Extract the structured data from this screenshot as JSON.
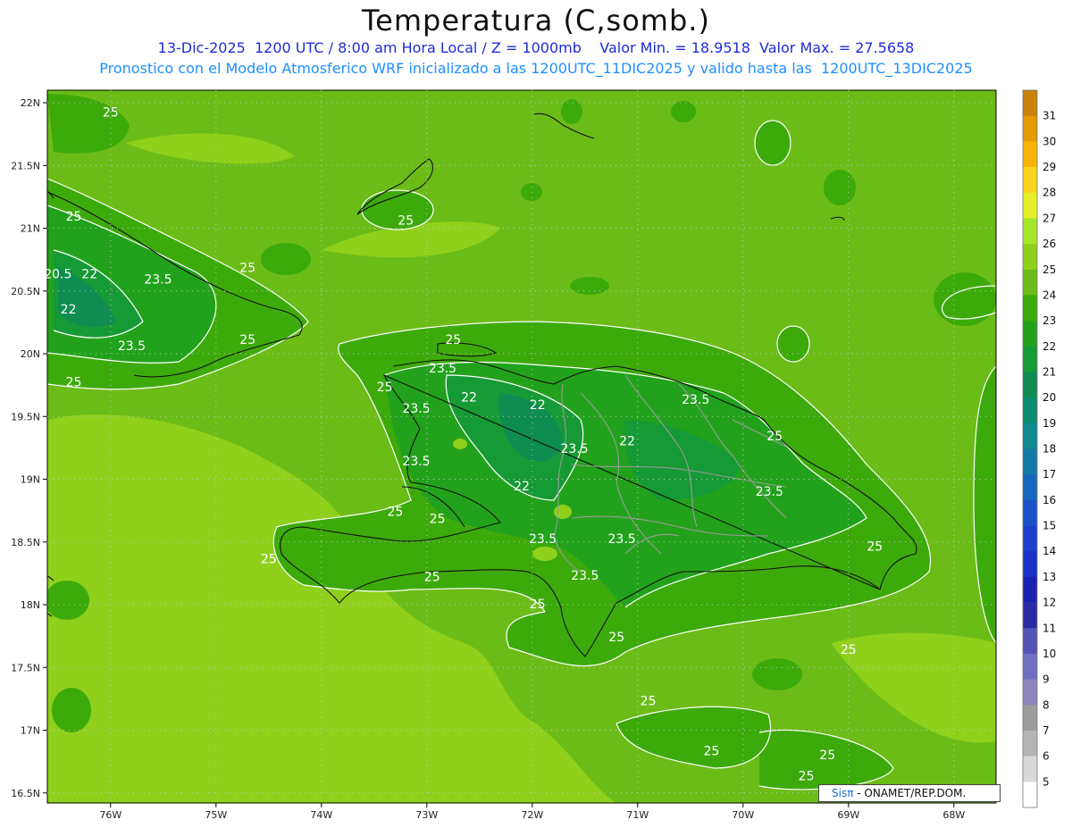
{
  "title": "Temperatura (C,somb.)",
  "subtitle_line1": "13-Dic-2025  1200 UTC / 8:00 am Hora Local / Z = 1000mb    Valor Min. = 18.9518  Valor Max. = 27.5658",
  "subtitle_line2": "Pronostico con el Modelo Atmosferico WRF inicializado a las 1200UTC_11DIC2025 y valido hasta las  1200UTC_13DIC2025",
  "credit": {
    "brand": "Sisπ",
    "text": " - ONAMET/REP.DOM."
  },
  "axes": {
    "lon_ticks": [
      "76W",
      "75W",
      "74W",
      "73W",
      "72W",
      "71W",
      "70W",
      "69W",
      "68W"
    ],
    "lon_values": [
      -76,
      -75,
      -74,
      -73,
      -72,
      -71,
      -70,
      -69,
      -68
    ],
    "lat_ticks": [
      "22N",
      "21.5N",
      "21N",
      "20.5N",
      "20N",
      "19.5N",
      "19N",
      "18.5N",
      "18N",
      "17.5N",
      "17N",
      "16.5N"
    ],
    "lat_values": [
      22,
      21.5,
      21,
      20.5,
      20,
      19.5,
      19,
      18.5,
      18,
      17.5,
      17,
      16.5
    ],
    "lon_range": [
      -76.6,
      -67.6
    ],
    "lat_range": [
      16.42,
      22.1
    ]
  },
  "colorbar": {
    "labels": [
      "31",
      "30",
      "29",
      "28",
      "27",
      "26",
      "25",
      "24",
      "23",
      "22",
      "21",
      "20",
      "19",
      "18",
      "17",
      "16",
      "15",
      "14",
      "13",
      "12",
      "11",
      "10",
      "9",
      "8",
      "7",
      "6",
      "5"
    ],
    "colors": [
      "#c8820a",
      "#e59a00",
      "#f7b400",
      "#fbd41e",
      "#e6ee2a",
      "#a6e62a",
      "#8fd01c",
      "#6cbc18",
      "#3daa0c",
      "#22a21c",
      "#169a36",
      "#0e8c52",
      "#0a8c70",
      "#0e8a8e",
      "#137aa8",
      "#1766bf",
      "#1c52c8",
      "#1c40cb",
      "#1a30c6",
      "#1c22b0",
      "#2a2aa6",
      "#5454b6",
      "#7070c2",
      "#8e86bc",
      "#9c9c9c",
      "#b4b4b4",
      "#d8d8d8",
      "#ffffff"
    ]
  },
  "contour_labels": [
    {
      "text": "25",
      "lon": -76.0,
      "lat": 21.89
    },
    {
      "text": "25",
      "lon": -73.2,
      "lat": 21.03
    },
    {
      "text": "25",
      "lon": -76.35,
      "lat": 21.06
    },
    {
      "text": "20.5",
      "lon": -76.5,
      "lat": 20.6
    },
    {
      "text": "22",
      "lon": -76.2,
      "lat": 20.6
    },
    {
      "text": "23.5",
      "lon": -75.55,
      "lat": 20.56
    },
    {
      "text": "22",
      "lon": -76.4,
      "lat": 20.32
    },
    {
      "text": "23.5",
      "lon": -75.8,
      "lat": 20.03
    },
    {
      "text": "25",
      "lon": -74.7,
      "lat": 20.65
    },
    {
      "text": "25",
      "lon": -74.7,
      "lat": 20.08
    },
    {
      "text": "25",
      "lon": -76.35,
      "lat": 19.74
    },
    {
      "text": "25",
      "lon": -73.4,
      "lat": 19.7
    },
    {
      "text": "25",
      "lon": -72.75,
      "lat": 20.08
    },
    {
      "text": "23.5",
      "lon": -72.85,
      "lat": 19.85
    },
    {
      "text": "23.5",
      "lon": -73.1,
      "lat": 19.53
    },
    {
      "text": "22",
      "lon": -72.6,
      "lat": 19.62
    },
    {
      "text": "22",
      "lon": -71.95,
      "lat": 19.56
    },
    {
      "text": "23.5",
      "lon": -73.1,
      "lat": 19.11
    },
    {
      "text": "23.5",
      "lon": -71.6,
      "lat": 19.21
    },
    {
      "text": "22",
      "lon": -72.1,
      "lat": 18.91
    },
    {
      "text": "22",
      "lon": -71.1,
      "lat": 19.27
    },
    {
      "text": "23.5",
      "lon": -70.45,
      "lat": 19.6
    },
    {
      "text": "25",
      "lon": -69.7,
      "lat": 19.31
    },
    {
      "text": "23.5",
      "lon": -69.75,
      "lat": 18.87
    },
    {
      "text": "25",
      "lon": -73.3,
      "lat": 18.71
    },
    {
      "text": "25",
      "lon": -72.9,
      "lat": 18.65
    },
    {
      "text": "23.5",
      "lon": -71.9,
      "lat": 18.49
    },
    {
      "text": "23.5",
      "lon": -71.15,
      "lat": 18.49
    },
    {
      "text": "23.5",
      "lon": -71.5,
      "lat": 18.2
    },
    {
      "text": "25",
      "lon": -71.95,
      "lat": 17.97
    },
    {
      "text": "25",
      "lon": -74.5,
      "lat": 18.33
    },
    {
      "text": "25",
      "lon": -72.95,
      "lat": 18.19
    },
    {
      "text": "25",
      "lon": -68.75,
      "lat": 18.43
    },
    {
      "text": "25",
      "lon": -71.2,
      "lat": 17.71
    },
    {
      "text": "25",
      "lon": -70.9,
      "lat": 17.2
    },
    {
      "text": "25",
      "lon": -69.0,
      "lat": 17.61
    },
    {
      "text": "25",
      "lon": -70.3,
      "lat": 16.8
    },
    {
      "text": "25",
      "lon": -69.2,
      "lat": 16.77
    },
    {
      "text": "25",
      "lon": -69.4,
      "lat": 16.6
    }
  ]
}
